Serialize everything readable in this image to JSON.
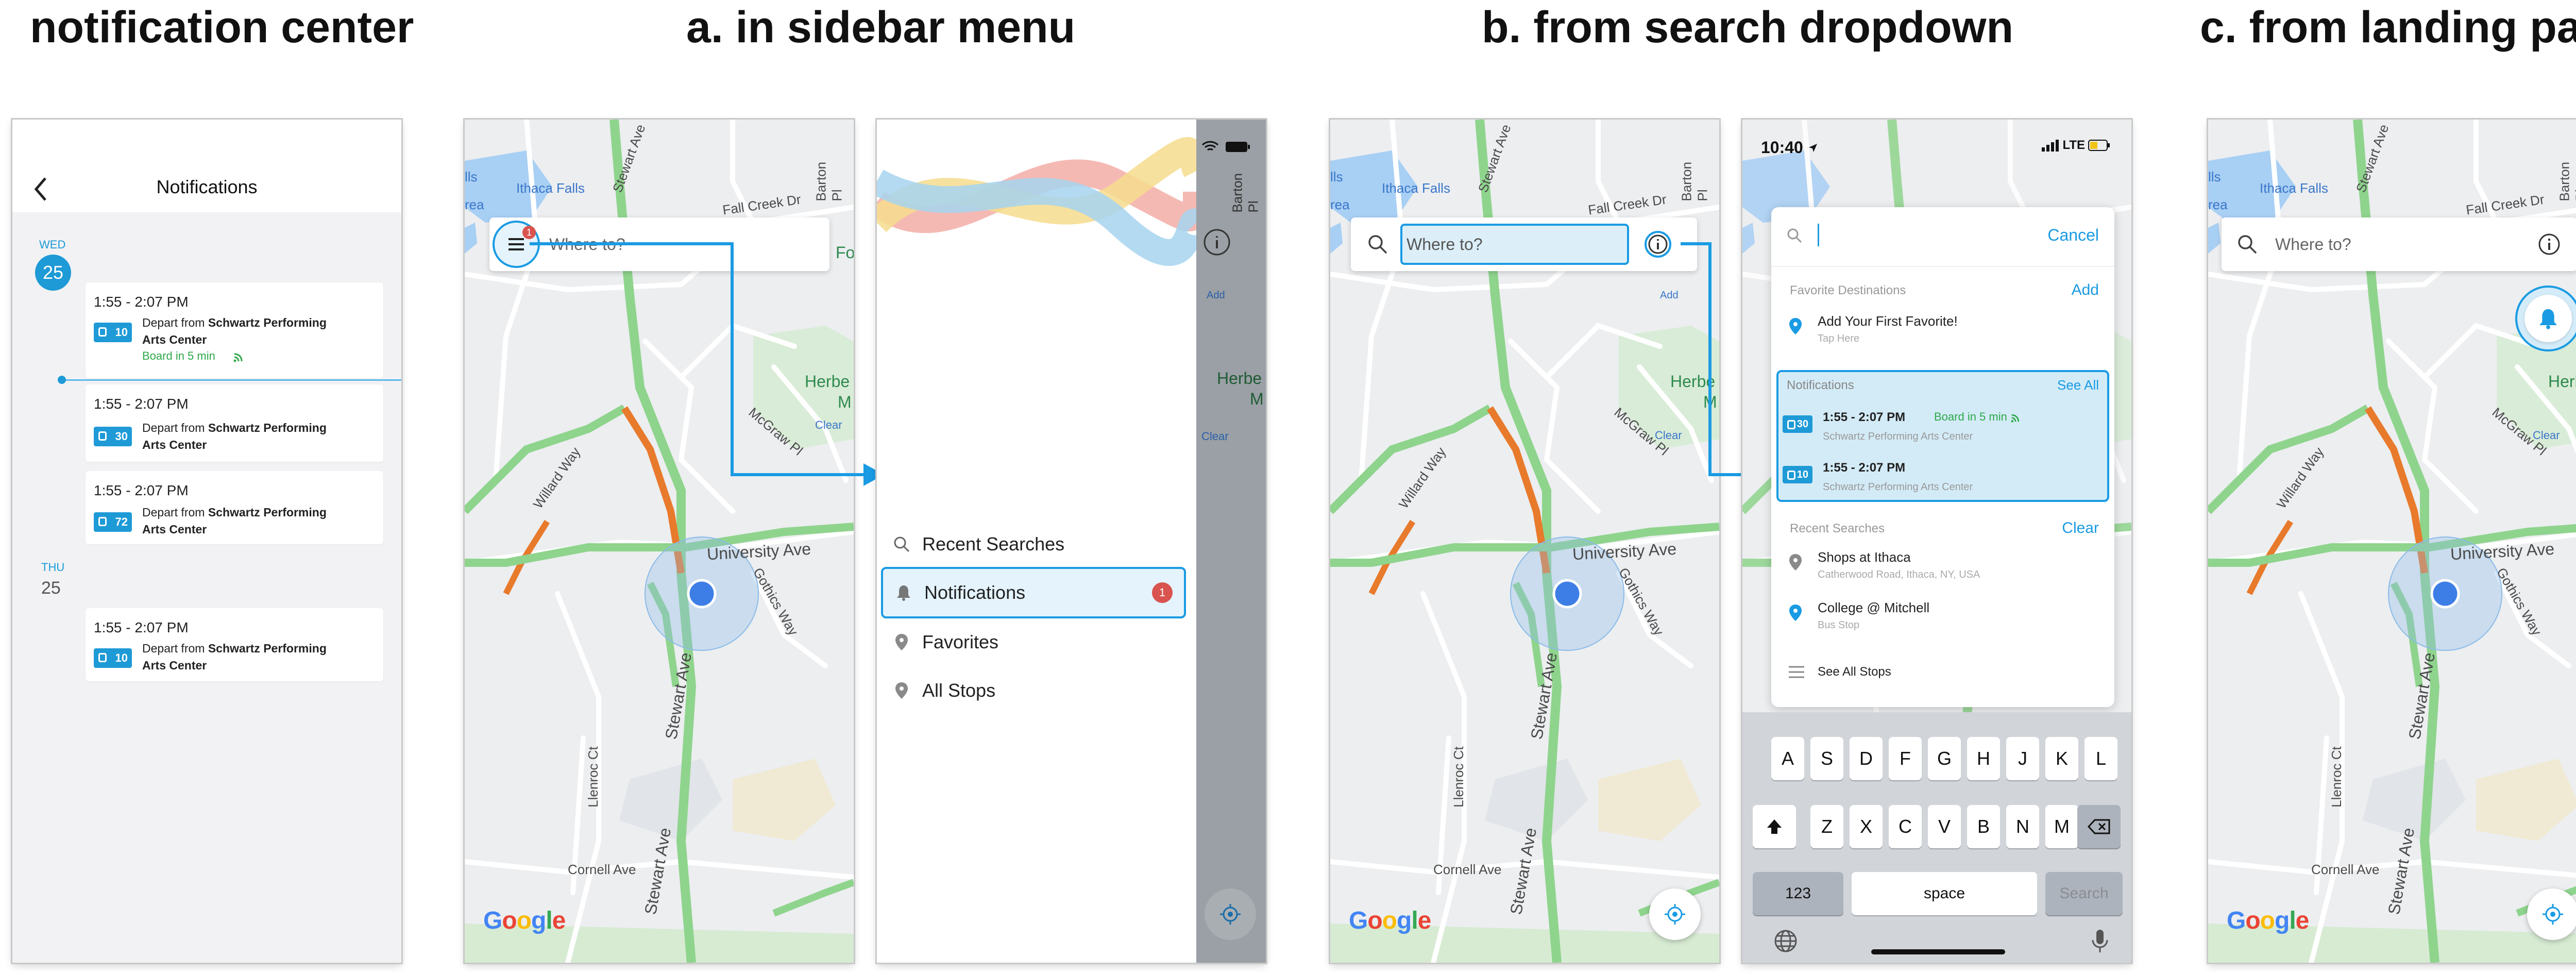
{
  "headings": {
    "notification_center": "notification center",
    "sidebar": "a. in sidebar menu",
    "search": "b. from search dropdown",
    "landing": "c. from landing page"
  },
  "colors": {
    "accent": "#1a9be3",
    "green": "#2ea84a",
    "badge_red": "#d9534f"
  },
  "notification_center": {
    "title": "Notifications",
    "back_icon": "chevron-left-icon",
    "days": [
      {
        "weekday": "WED",
        "date": "25",
        "selected": true
      },
      {
        "weekday": "THU",
        "date": "25",
        "selected": false
      }
    ],
    "cards": [
      {
        "time": "1:55 - 2:07 PM",
        "route": "10",
        "depart": "Depart from ",
        "stop": "Schwartz Performing Arts Center",
        "board": "Board in 5 min"
      },
      {
        "time": "1:55 - 2:07 PM",
        "route": "30",
        "depart": "Depart from ",
        "stop": "Schwartz Performing Arts Center"
      },
      {
        "time": "1:55 - 2:07 PM",
        "route": "72",
        "depart": "Depart from ",
        "stop": "Schwartz Performing Arts Center"
      },
      {
        "time": "1:55 - 2:07 PM",
        "route": "10",
        "depart": "Depart from ",
        "stop": "Schwartz Performing Arts Center"
      }
    ]
  },
  "map": {
    "labels": {
      "ithaca_falls": "Ithaca Falls",
      "stewart_ave": "Stewart Ave",
      "fall_creek": "Fall Creek Dr",
      "barton": "Barton Pl",
      "herbert": "Herbe",
      "mcgraw": "McGraw Pl",
      "clear": "Clear",
      "willard": "Willard Way",
      "university": "University Ave",
      "gothics": "Gothics Way",
      "llenroc": "Llenroc Ct",
      "cornell": "Cornell Ave",
      "add": "Add",
      "lls": "lls",
      "rea": "rea",
      "fo": "Fo",
      "m": "M"
    },
    "google": [
      "G",
      "o",
      "o",
      "g",
      "l",
      "e"
    ],
    "search_placeholder": "Where to?",
    "badge_count": "1"
  },
  "sidebar": {
    "items": [
      {
        "label": "Recent Searches",
        "icon": "search-icon"
      },
      {
        "label": "Notifications",
        "icon": "bell-icon",
        "badge": "1",
        "highlighted": true
      },
      {
        "label": "Favorites",
        "icon": "pin-icon"
      },
      {
        "label": "All Stops",
        "icon": "pin-icon"
      }
    ]
  },
  "search_dropdown": {
    "status_time": "10:40",
    "status_net": "LTE",
    "cancel": "Cancel",
    "favorites_header": "Favorite Destinations",
    "favorites_add": "Add",
    "add_favorite_title": "Add Your First Favorite!",
    "add_favorite_sub": "Tap Here",
    "notifications_header": "Notifications",
    "see_all": "See All",
    "notifications": [
      {
        "route": "30",
        "time": "1:55 - 2:07 PM",
        "board": "Board in 5 min",
        "stop": "Schwartz Performing Arts Center"
      },
      {
        "route": "10",
        "time": "1:55 - 2:07 PM",
        "stop": "Schwartz Performing Arts Center"
      }
    ],
    "recent_header": "Recent Searches",
    "clear": "Clear",
    "recent": [
      {
        "title": "Shops at Ithaca",
        "sub": "Catherwood Road, Ithaca, NY, USA"
      },
      {
        "title": "College @ Mitchell",
        "sub": "Bus Stop"
      }
    ],
    "see_all_stops": "See All Stops",
    "keyboard": {
      "row1": [
        "A",
        "S",
        "D",
        "F",
        "G",
        "H",
        "J",
        "K",
        "L"
      ],
      "row2": [
        "Z",
        "X",
        "C",
        "V",
        "B",
        "N",
        "M"
      ],
      "num": "123",
      "space": "space",
      "search": "Search"
    }
  }
}
